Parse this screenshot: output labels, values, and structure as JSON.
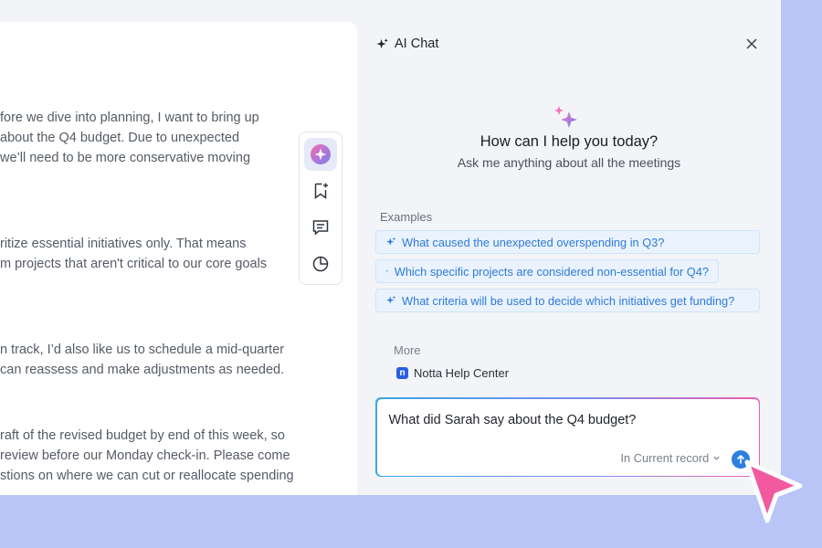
{
  "document": {
    "paragraphs": [
      [
        "fore we dive into planning, I want to bring up",
        " about the Q4 budget. Due to unexpected",
        "we’ll need to be more conservative moving"
      ],
      [
        "ritize essential initiatives only. That means",
        "m projects that aren't critical to our core goals"
      ],
      [
        "n track, I’d also like us to schedule a mid-quarter",
        "can reassess and make adjustments as needed."
      ],
      [
        "raft of the revised budget by end of this week, so",
        " review before our Monday check-in. Please come",
        "stions on where we can cut or reallocate spending"
      ]
    ]
  },
  "toolbar": {
    "items": [
      "ai-sparkle-icon",
      "bookmark-plus-icon",
      "comment-icon",
      "pie-chart-icon"
    ]
  },
  "chat": {
    "title": "AI Chat",
    "hero_title": "How can I help you today?",
    "hero_subtitle": "Ask me anything about all the meetings",
    "examples_label": "Examples",
    "examples": [
      "What caused the unexpected overspending in Q3?",
      "Which specific projects are considered non-essential for Q4?",
      "What criteria will be used to decide which initiatives get funding?"
    ],
    "more_label": "More",
    "help_link": "Notta Help Center",
    "help_logo": "n",
    "input_value": "What did Sarah say about the Q4 budget?",
    "scope": "In Current record"
  },
  "colors": {
    "accent": "#2d7fe0",
    "chip_bg": "#eaf3fd",
    "cursor": "#f25aa0",
    "frame": "#b9c5f7"
  }
}
